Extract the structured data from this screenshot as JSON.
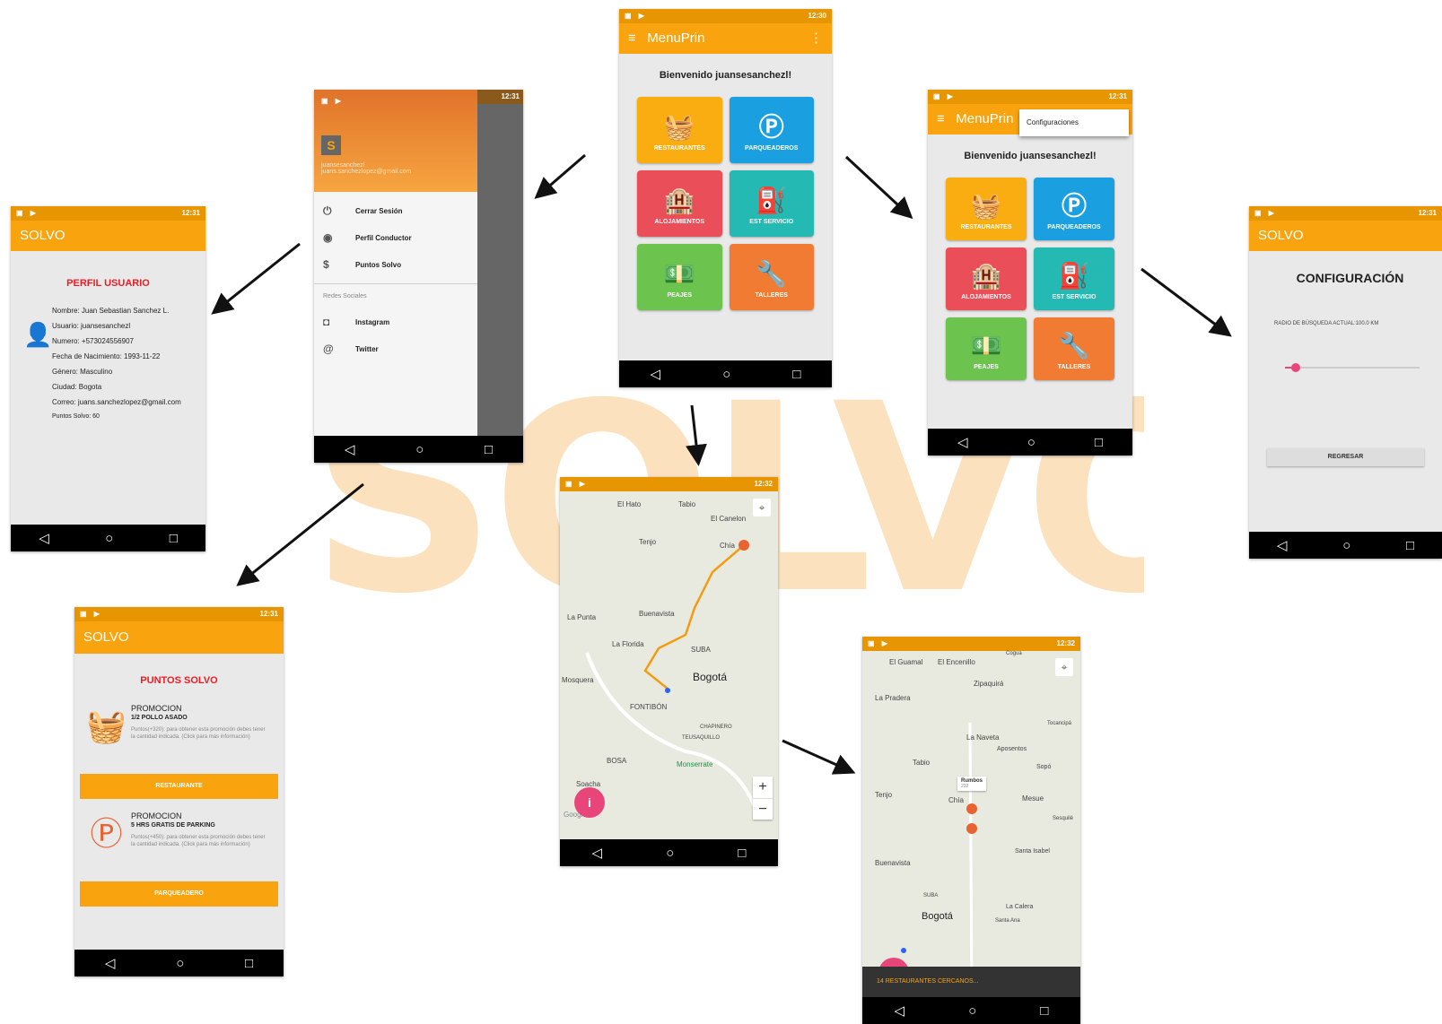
{
  "background_logo": "SOLVO",
  "status": {
    "time_a": "12:30",
    "time_b": "12:31",
    "time_c": "12:32"
  },
  "nav": {
    "back": "◁",
    "home": "○",
    "recent": "□"
  },
  "main_menu": {
    "title": "MenuPrin",
    "welcome": "Bienvenido juansesanchezl!",
    "tiles": [
      {
        "label": "RESTAURANTES",
        "icon": "food-basket-icon",
        "color": "#f9ad10"
      },
      {
        "label": "PARQUEADEROS",
        "icon": "parking-pin-icon",
        "color": "#1aa0e0"
      },
      {
        "label": "ALOJAMIENTOS",
        "icon": "hotel-icon",
        "color": "#ea4e59"
      },
      {
        "label": "EST SERVICIO",
        "icon": "gas-station-icon",
        "color": "#25b9b4"
      },
      {
        "label": "PEAJES",
        "icon": "toll-money-icon",
        "color": "#6cc34e"
      },
      {
        "label": "TALLERES",
        "icon": "tools-icon",
        "color": "#f17b32"
      }
    ]
  },
  "menu_config": {
    "popup": "Configuraciones"
  },
  "drawer": {
    "user": "juansesanchezl",
    "email": "juans.sanchezlopez@gmail.com",
    "items": [
      "Cerrar Sesión",
      "Perfil Conductor",
      "Puntos Solvo"
    ],
    "section": "Redes Sociales",
    "social": [
      "Instagram",
      "Twitter"
    ]
  },
  "profile": {
    "appbar": "SOLVO",
    "title": "PERFIL USUARIO",
    "lines": [
      "Nombre: Juan Sebastian Sanchez L.",
      "Usuario: juansesanchezl",
      "Numero: +573024556907",
      "Fecha de Nacimiento: 1993-11-22",
      "Género: Masculino",
      "Ciudad: Bogota",
      "Correo: juans.sanchezlopez@gmail.com",
      "Puntos Solvo: 60"
    ]
  },
  "settings": {
    "appbar": "SOLVO",
    "title": "CONFIGURACIÓN",
    "radius_label": "RADIO DE BÚSQUEDA ACTUAL:100.0 KM",
    "slider_value": 0.08,
    "back_button": "REGRESAR"
  },
  "points": {
    "appbar": "SOLVO",
    "title": "PUNTOS SOLVO",
    "promos": [
      {
        "heading": "PROMOCION",
        "name": "1/2 POLLO ASADO",
        "desc": "Puntos(+320): para obtener esta promoción debes tener la cantidad indicada. (Click para más información)",
        "button": "RESTAURANTE",
        "icon": "food-basket-icon"
      },
      {
        "heading": "PROMOCION",
        "name": "5 HRS GRATIS DE PARKING",
        "desc": "Puntos(+450): para obtener esta promoción debes tener la cantidad indicada. (Click para más información)",
        "button": "PARQUEADERO",
        "icon": "parking-pin-icon"
      }
    ]
  },
  "map1": {
    "places": [
      "El Hato",
      "Tabio",
      "El Canelon",
      "Tenjo",
      "Chía",
      "La Punta",
      "Buenavista",
      "La Florida",
      "SUBA",
      "Mosquera",
      "Bogotá",
      "FONTIBÓN",
      "CHAPINERO",
      "TEUSAQUILLO",
      "BOSA",
      "Monserrate",
      "Soacha",
      "Google"
    ],
    "zoom_in": "+",
    "zoom_out": "−",
    "fab": "i"
  },
  "map2": {
    "places": [
      "El Guamal",
      "El Encenillo",
      "Cogua",
      "Zipaquirá",
      "La Pradera",
      "Tocancipá",
      "La Naveta",
      "Aposentos",
      "Sopó",
      "Tabio",
      "Tenjo",
      "Chía",
      "Mesue",
      "Sesquilé",
      "Santa Isabel",
      "Buenavista",
      "SUBA",
      "Bogotá",
      "La Calera",
      "Santa Ana"
    ],
    "pin_label": "Rumbos",
    "pin_sub": "232",
    "snackbar": "14 RESTAURANTES CERCANOS..."
  }
}
